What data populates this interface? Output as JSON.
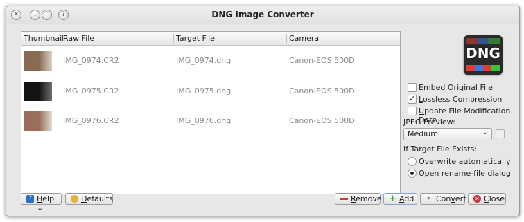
{
  "window": {
    "title": "DNG Image Converter",
    "titlebar_buttons": [
      "close-icon",
      "minimize-icon",
      "maximize-icon",
      "help-icon"
    ]
  },
  "table": {
    "columns": [
      "Thumbnail",
      "Raw File",
      "Target File",
      "Camera"
    ],
    "rows": [
      {
        "raw": "IMG_0974.CR2",
        "target": "IMG_0974.dng",
        "camera": "Canon-EOS 500D",
        "thumb_colors": [
          "#8a6b52",
          "#d9d2c8"
        ]
      },
      {
        "raw": "IMG_0975.CR2",
        "target": "IMG_0975.dng",
        "camera": "Canon-EOS 500D",
        "thumb_colors": [
          "#141414",
          "#6e6e6e"
        ]
      },
      {
        "raw": "IMG_0976.CR2",
        "target": "IMG_0976.dng",
        "camera": "Canon-EOS 500D",
        "thumb_colors": [
          "#9a6e5a",
          "#e2dcd6"
        ]
      }
    ]
  },
  "side": {
    "logo_text": "DNG",
    "logo_colors": [
      "#e23a3a",
      "#3a78e2",
      "#3ac33a"
    ],
    "embed_label_pre": "",
    "embed_label_ul": "E",
    "embed_label_post": "mbed Original File",
    "embed_checked": false,
    "lossless_label_ul": "L",
    "lossless_label_post": "ossless Compression",
    "lossless_checked": true,
    "update_label_ul": "U",
    "update_label_post": "pdate File Modification Date",
    "update_checked": false,
    "jpeg_label": "JPEG Preview:",
    "jpeg_value": "Medium",
    "exists_label": "If Target File Exists:",
    "overwrite_ul": "O",
    "overwrite_post": "verwrite automatically",
    "overwrite_selected": false,
    "rename_label": "Open rename-file dialog",
    "rename_selected": true
  },
  "buttons": {
    "help_ul": "H",
    "help_post": "elp",
    "defaults_ul": "D",
    "defaults_post": "efaults",
    "remove_ul": "R",
    "remove_post": "emove",
    "add_ul": "A",
    "add_post": "dd",
    "convert_pre": "Con",
    "convert_ul": "v",
    "convert_post": "ert",
    "close_ul": "C",
    "close_post": "lose",
    "accent_remove": "#d23a3a",
    "accent_add": "#3aa53a",
    "accent_close": "#c83232"
  }
}
